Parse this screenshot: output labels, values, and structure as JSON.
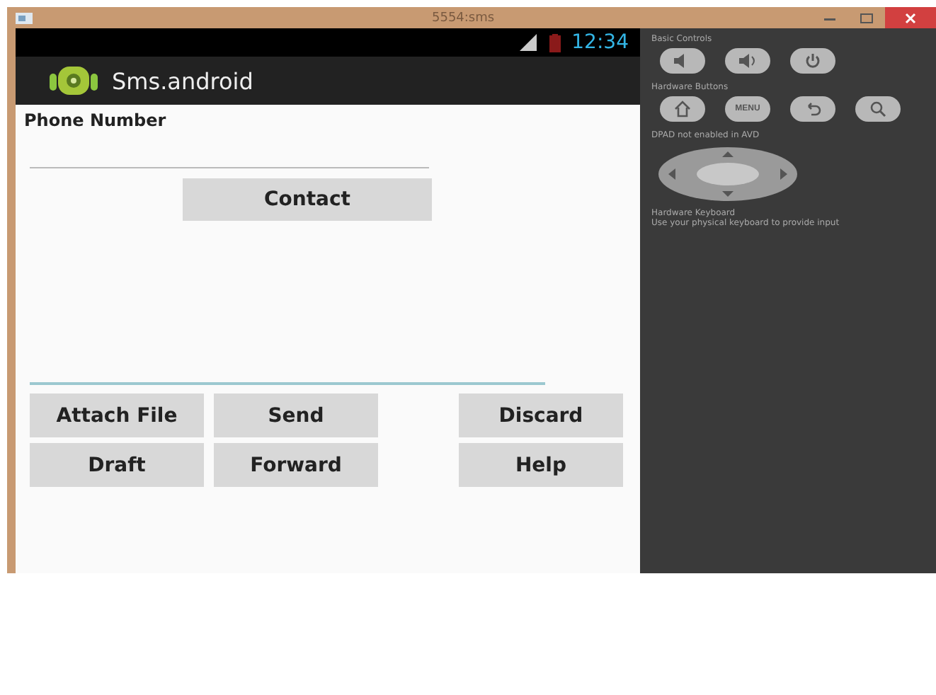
{
  "window": {
    "title": "5554:sms"
  },
  "status_bar": {
    "time": "12:34"
  },
  "action_bar": {
    "title": "Sms.android"
  },
  "form": {
    "phone_label": "Phone Number",
    "contact_button": "Contact"
  },
  "buttons": [
    {
      "label": "Attach File"
    },
    {
      "label": "Send"
    },
    {
      "label": "Discard"
    },
    {
      "label": "Draft"
    },
    {
      "label": "Forward"
    },
    {
      "label": "Help"
    }
  ],
  "controls": {
    "basic_title": "Basic Controls",
    "hardware_title": "Hardware Buttons",
    "menu_key": "MENU",
    "dpad_note": "DPAD not enabled in AVD",
    "keyboard_title": "Hardware Keyboard",
    "keyboard_note": "Use your physical keyboard to provide input"
  }
}
